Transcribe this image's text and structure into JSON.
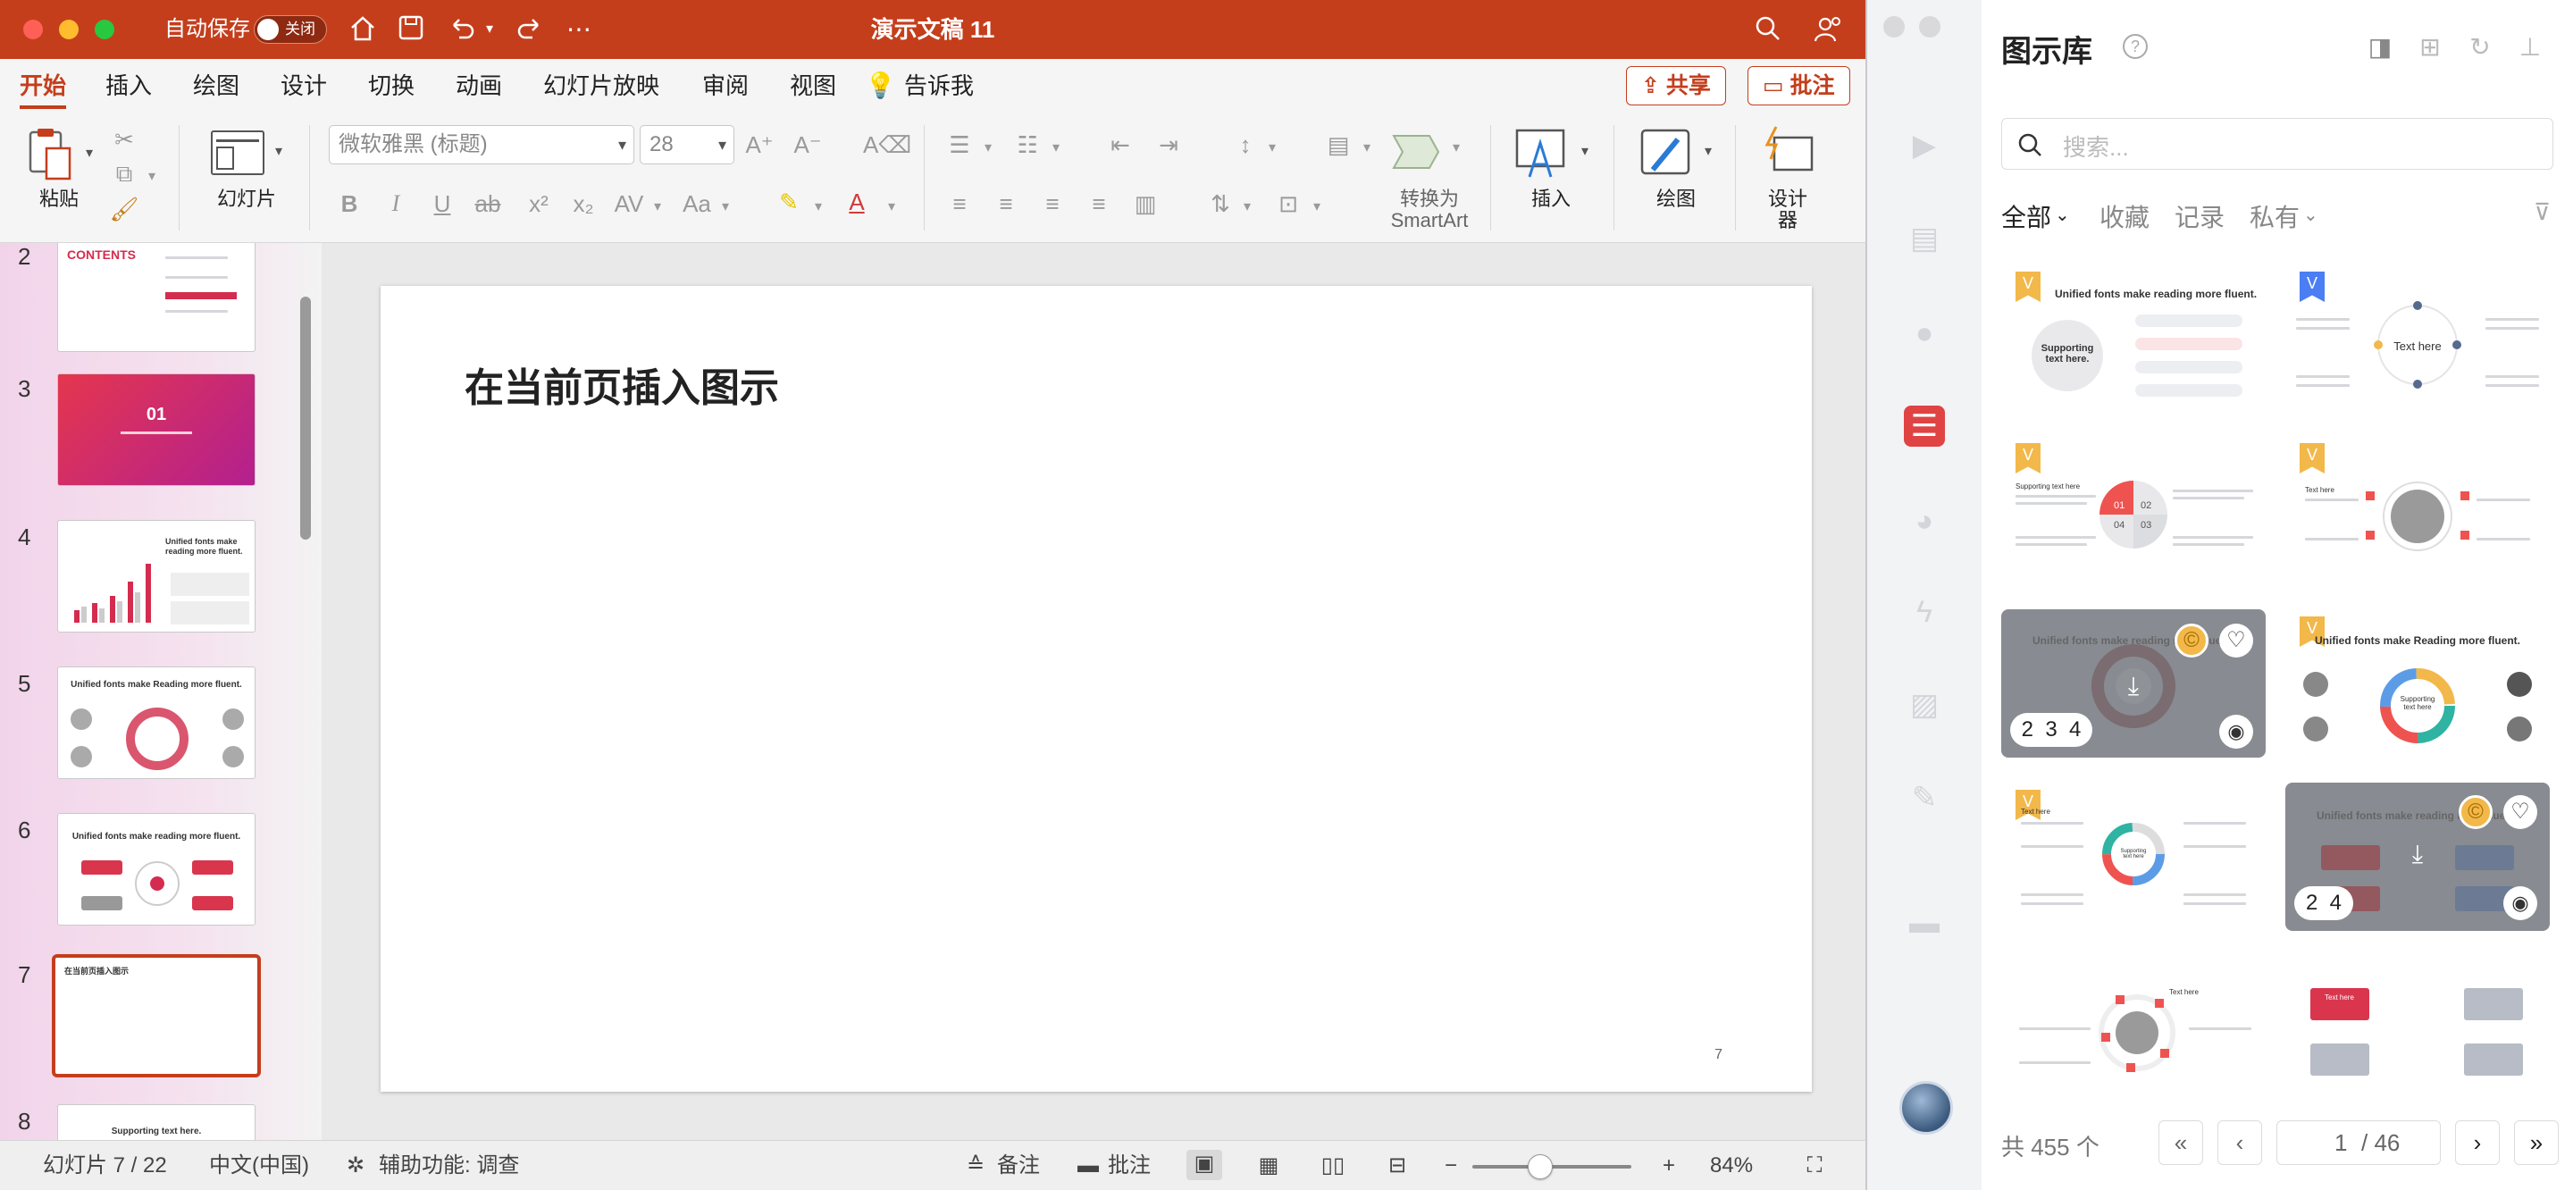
{
  "app": {
    "title": "演示文稿 11",
    "autosave_label": "自动保存",
    "autosave_state": "关闭"
  },
  "menu": {
    "tabs": [
      "开始",
      "插入",
      "绘图",
      "设计",
      "切换",
      "动画",
      "幻灯片放映",
      "审阅",
      "视图",
      "告诉我"
    ],
    "share_label": "共享",
    "comment_label": "批注"
  },
  "ribbon": {
    "paste_label": "粘贴",
    "slide_label": "幻灯片",
    "font_name": "微软雅黑 (标题)",
    "font_size": "28",
    "smartart_label_1": "转换为",
    "smartart_label_2": "SmartArt",
    "insert_label": "插入",
    "draw_label": "绘图",
    "designer_label_1": "设计",
    "designer_label_2": "器",
    "format_buttons": [
      "B",
      "I",
      "U",
      "ab",
      "x²",
      "x₂",
      "AV",
      "Aa"
    ]
  },
  "thumbnails": [
    {
      "num": "2",
      "text": "CONTENTS"
    },
    {
      "num": "3",
      "text": "01"
    },
    {
      "num": "4",
      "text": "Unified fonts make reading more fluent."
    },
    {
      "num": "5",
      "text": "Unified fonts make Reading more fluent."
    },
    {
      "num": "6",
      "text": "Unified fonts make reading more fluent."
    },
    {
      "num": "7",
      "text": "在当前页插入图示"
    },
    {
      "num": "8",
      "text": "Supporting text here."
    }
  ],
  "slide": {
    "title": "在当前页插入图示",
    "page_number": "7"
  },
  "status": {
    "slide_info": "幻灯片 7 / 22",
    "language": "中文(中国)",
    "accessibility": "辅助功能: 调查",
    "notes_label": "备注",
    "comments_label": "批注",
    "zoom": "84%",
    "zoom_fraction": 0.42
  },
  "panel": {
    "title": "图示库",
    "search_placeholder": "搜索...",
    "filters": [
      "全部",
      "收藏",
      "记录",
      "私有"
    ],
    "cards": [
      {
        "title": "Unified fonts make reading more fluent.",
        "badge": "V",
        "subtitle": "Supporting text here."
      },
      {
        "title": "Text here",
        "badge": "V"
      },
      {
        "title": "Supporting text here",
        "badge": "V",
        "labels": [
          "01",
          "02",
          "04",
          "03"
        ]
      },
      {
        "title": "Text here",
        "badge": "V"
      },
      {
        "title": "Unified fonts make reading more fluent.",
        "badge": "",
        "overlay_numbers": "2  3  4"
      },
      {
        "title": "Unified fonts make Reading more fluent.",
        "badge": "V",
        "subtitle": "Supporting text here"
      },
      {
        "title": "Text here",
        "badge": "V",
        "subtitle": "Supporting text here"
      },
      {
        "title": "Unified fonts make reading more fluent.",
        "badge": "",
        "overlay_numbers": "2  4"
      },
      {
        "title": "Text here",
        "badge": ""
      },
      {
        "title": "Text here",
        "badge": ""
      }
    ],
    "total_label": "共 455 个",
    "page_current": "1",
    "page_total": "/ 46"
  },
  "colors": {
    "brand": "#c43e1c",
    "panel_accent": "#e04343",
    "badge_gold": "#f2b84a",
    "badge_blue": "#4a7ef2"
  }
}
